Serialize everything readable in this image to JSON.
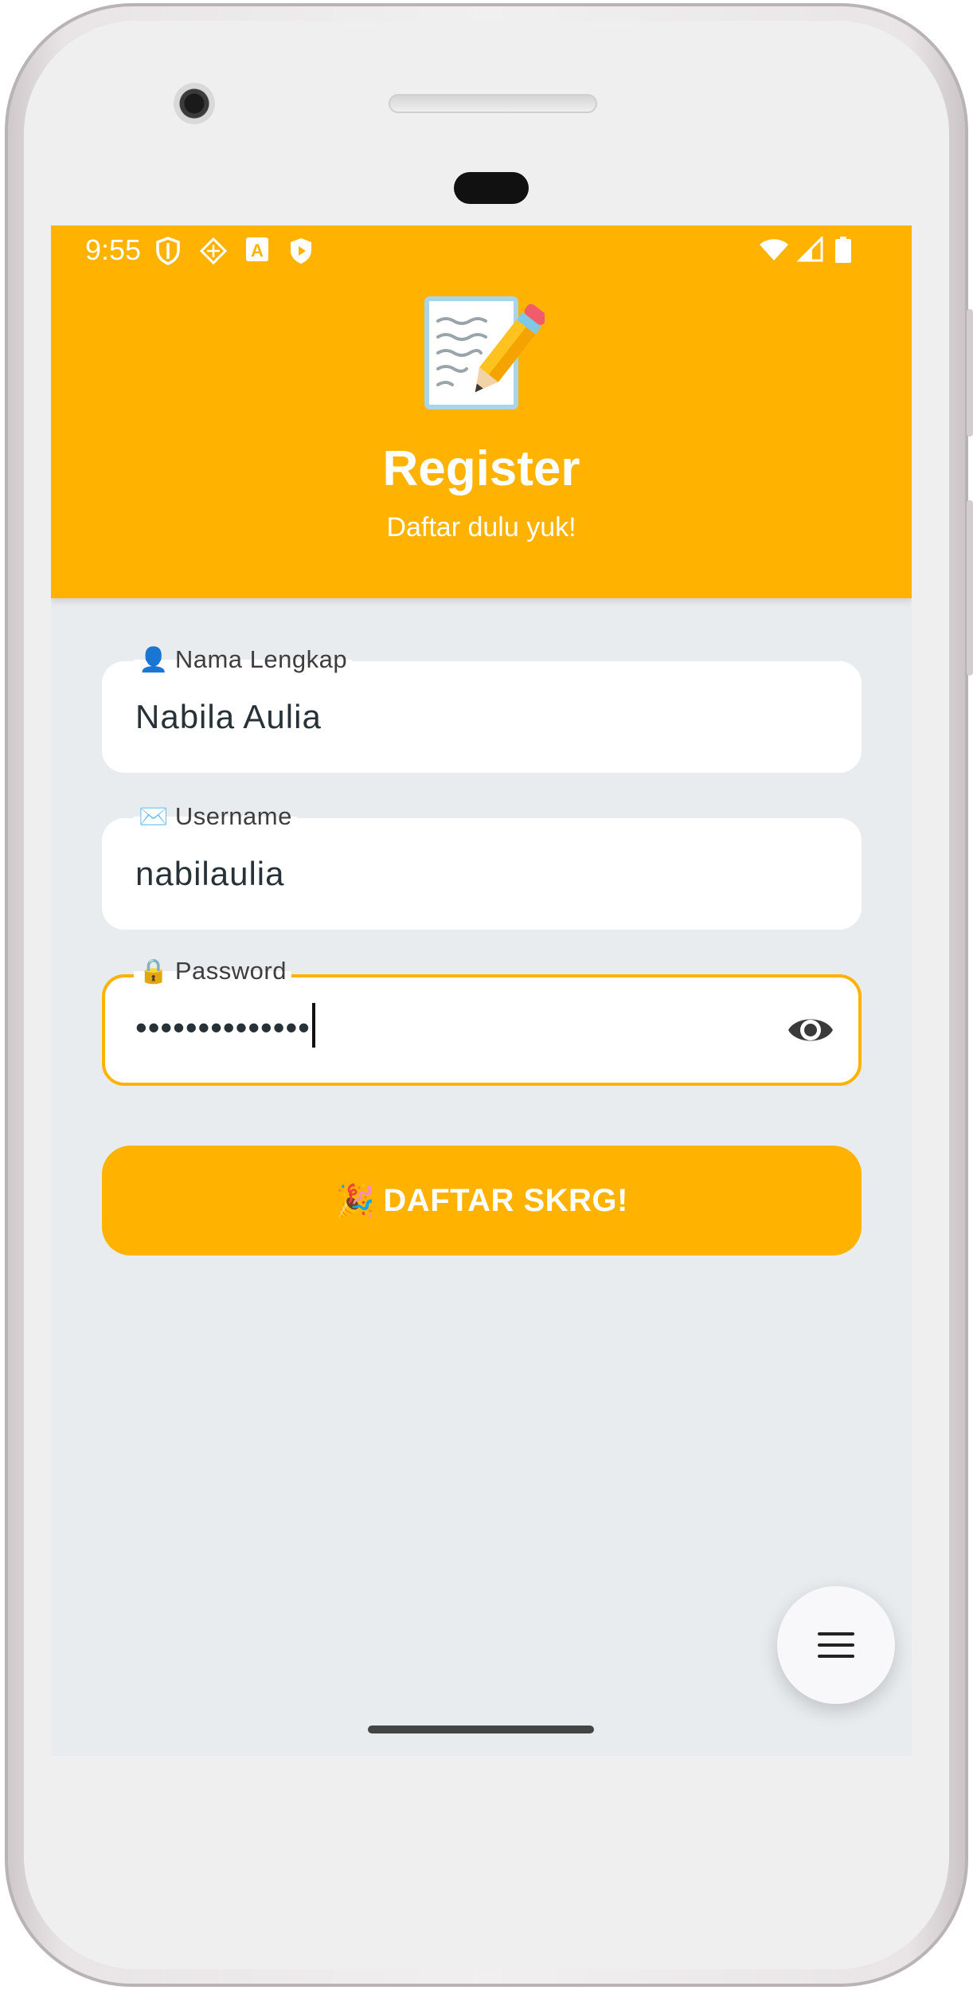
{
  "status_bar": {
    "time": "9:55",
    "left_icons": [
      "shield-icon",
      "drive-icon",
      "a-badge-icon",
      "play-shield-icon"
    ],
    "right_icons": [
      "wifi-icon",
      "signal-icon",
      "battery-icon"
    ]
  },
  "header": {
    "emoji": "📝",
    "title": "Register",
    "subtitle": "Daftar dulu yuk!",
    "background": "#ffb300"
  },
  "form": {
    "full_name": {
      "emoji": "👤",
      "label": "Nama Lengkap",
      "value": "Nabila Aulia"
    },
    "username": {
      "emoji": "✉️",
      "label": "Username",
      "value": "nabilaulia"
    },
    "password": {
      "emoji": "🔒",
      "label": "Password",
      "value": "••••••••••••••",
      "toggle_icon": "eye-icon",
      "focused": true
    }
  },
  "submit_button": {
    "emoji": "🎉",
    "label": "DAFTAR SKRG!"
  },
  "fab": {
    "icon": "menu-icon"
  },
  "colors": {
    "accent": "#ffb300",
    "background": "#e9ecef",
    "text": "#263238"
  }
}
